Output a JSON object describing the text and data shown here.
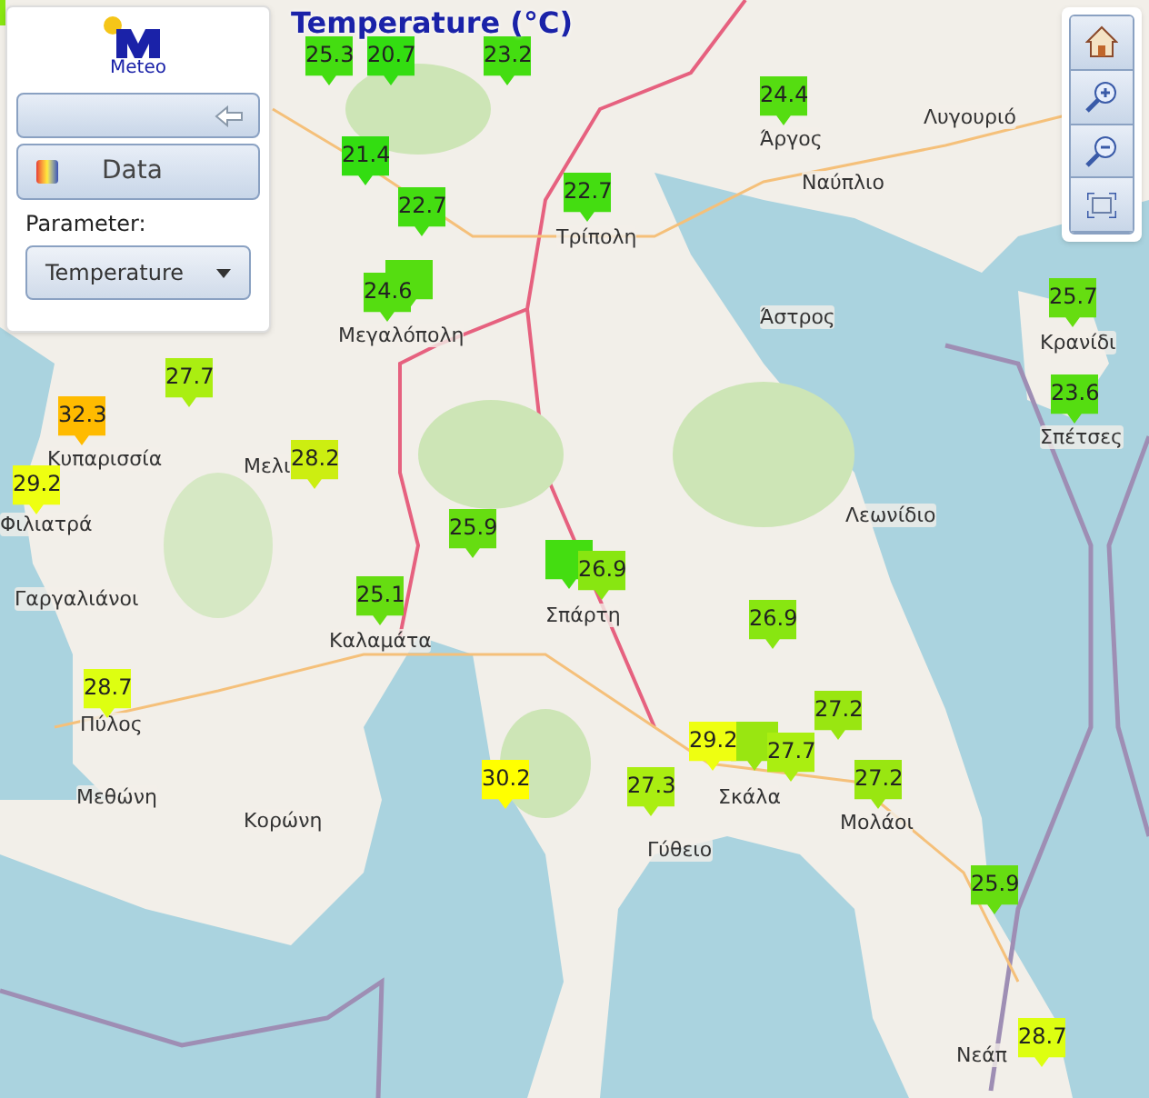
{
  "title": "Temperature (°C)",
  "panel": {
    "logo_text": "Meteo",
    "data_button": "Data",
    "parameter_label": "Parameter:",
    "parameter_select": "Temperature"
  },
  "places": [
    "Άργος",
    "Ναύπλιο",
    "Λυγουριό",
    "Τρίπολη",
    "Μεγαλόπολη",
    "Άστρος",
    "Κρανίδι",
    "Σπέτσες",
    "Κυπαρισσία",
    "Μελι",
    "Φιλιατρά",
    "Λεωνίδιο",
    "Γαργαλιάνοι",
    "Καλαμάτα",
    "Σπάρτη",
    "Πύλος",
    "Σκάλα",
    "Μολάοι",
    "Μεθώνη",
    "Κορώνη",
    "Γύθειο",
    "Νεάπ"
  ],
  "markers": [
    {
      "value": "25.3",
      "color": "#44dd11"
    },
    {
      "value": "20.7",
      "color": "#33dd11"
    },
    {
      "value": "23.2",
      "color": "#44dd11"
    },
    {
      "value": "21.4",
      "color": "#33dd11"
    },
    {
      "value": "22.7",
      "color": "#44dd11"
    },
    {
      "value": "24.6",
      "color": "#55dd11"
    },
    {
      "value": "22.7",
      "color": "#44dd11"
    },
    {
      "value": "24.4",
      "color": "#55dd11"
    },
    {
      "value": "25.7",
      "color": "#66dd11"
    },
    {
      "value": "23.6",
      "color": "#55dd11"
    },
    {
      "value": "27.7",
      "color": "#aaee11"
    },
    {
      "value": "32.3",
      "color": "#ffbb00"
    },
    {
      "value": "29.2",
      "color": "#eeff11"
    },
    {
      "value": "28.2",
      "color": "#ccee11"
    },
    {
      "value": "25.9",
      "color": "#66dd11"
    },
    {
      "value": "25.1",
      "color": "#66dd11"
    },
    {
      "value": "26.9",
      "color": "#88e611"
    },
    {
      "value": "26.9",
      "color": "#88e611"
    },
    {
      "value": "27.2",
      "color": "#99e611"
    },
    {
      "value": "29.2",
      "color": "#eeff11"
    },
    {
      "value": "27.7",
      "color": "#aaee11"
    },
    {
      "value": "27.2",
      "color": "#99e611"
    },
    {
      "value": "27.3",
      "color": "#aaee11"
    },
    {
      "value": "30.2",
      "color": "#ffff00"
    },
    {
      "value": "28.7",
      "color": "#ddff11"
    },
    {
      "value": "25.9",
      "color": "#66dd11"
    },
    {
      "value": "28.7",
      "color": "#ddff11"
    }
  ]
}
